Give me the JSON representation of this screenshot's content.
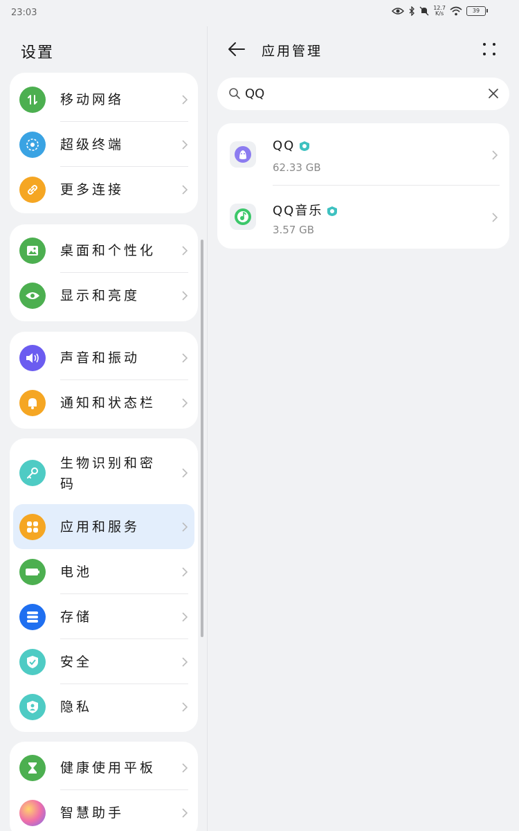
{
  "status_bar": {
    "time": "23:03",
    "net_speed_value": "12.7",
    "net_speed_unit": "K/s",
    "battery": "39"
  },
  "left": {
    "title": "设置",
    "groups": [
      {
        "items": [
          {
            "label": "移动网络",
            "icon": "mobile-network-icon",
            "color": "#4caf50"
          },
          {
            "label": "超级终端",
            "icon": "super-device-icon",
            "color": "#3aa3e3"
          },
          {
            "label": "更多连接",
            "icon": "link-icon",
            "color": "#f5a623"
          }
        ]
      },
      {
        "items": [
          {
            "label": "桌面和个性化",
            "icon": "wallpaper-icon",
            "color": "#4caf50"
          },
          {
            "label": "显示和亮度",
            "icon": "eye-icon",
            "color": "#4caf50"
          }
        ]
      },
      {
        "items": [
          {
            "label": "声音和振动",
            "icon": "speaker-icon",
            "color": "#6b5cf0"
          },
          {
            "label": "通知和状态栏",
            "icon": "bell-icon",
            "color": "#f5a623"
          }
        ]
      },
      {
        "items": [
          {
            "label": "生物识别和密码",
            "icon": "key-icon",
            "color": "#4ecbc4"
          },
          {
            "label": "应用和服务",
            "icon": "apps-icon",
            "color": "#f5a623"
          },
          {
            "label": "电池",
            "icon": "battery-icon",
            "color": "#4caf50"
          },
          {
            "label": "存储",
            "icon": "storage-icon",
            "color": "#1f6ff0"
          },
          {
            "label": "安全",
            "icon": "shield-icon",
            "color": "#4ecbc4"
          },
          {
            "label": "隐私",
            "icon": "privacy-icon",
            "color": "#4ecbc4"
          }
        ]
      },
      {
        "items": [
          {
            "label": "健康使用平板",
            "icon": "hourglass-icon",
            "color": "#4caf50"
          },
          {
            "label": "智慧助手",
            "icon": "assistant-icon",
            "color": "#e06fd0"
          }
        ]
      }
    ]
  },
  "right": {
    "title": "应用管理",
    "search": {
      "value": "QQ"
    },
    "apps": [
      {
        "name": "QQ",
        "size": "62.33 GB",
        "icon": "qq-icon"
      },
      {
        "name": "QQ音乐",
        "size": "3.57 GB",
        "icon": "qq-music-icon"
      }
    ]
  }
}
